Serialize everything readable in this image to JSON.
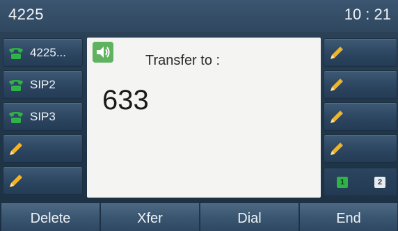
{
  "status_bar": {
    "account": "4225",
    "time": "10 : 21"
  },
  "line_keys_left": [
    {
      "label": "4225...",
      "icon": "phone-icon",
      "icon_color": "#2fb24a"
    },
    {
      "label": "SIP2",
      "icon": "phone-icon",
      "icon_color": "#2fb24a"
    },
    {
      "label": "SIP3",
      "icon": "phone-icon",
      "icon_color": "#2fb24a"
    },
    {
      "label": "",
      "icon": "pencil-icon"
    },
    {
      "label": "",
      "icon": "pencil-icon"
    }
  ],
  "line_keys_right": [
    {
      "label": "",
      "icon": "pencil-icon"
    },
    {
      "label": "",
      "icon": "pencil-icon"
    },
    {
      "label": "",
      "icon": "pencil-icon"
    },
    {
      "label": "",
      "icon": "pencil-icon"
    }
  ],
  "transfer_panel": {
    "prompt": "Transfer to :",
    "number": "633",
    "icon": "speaker-icon",
    "icon_color": "#5fb360"
  },
  "page_indicator": {
    "pages": [
      "1",
      "2"
    ],
    "active_page": "1",
    "active_color": "#2fb24a"
  },
  "softkeys": [
    {
      "label": "Delete"
    },
    {
      "label": "Xfer"
    },
    {
      "label": "Dial"
    },
    {
      "label": "End"
    }
  ]
}
